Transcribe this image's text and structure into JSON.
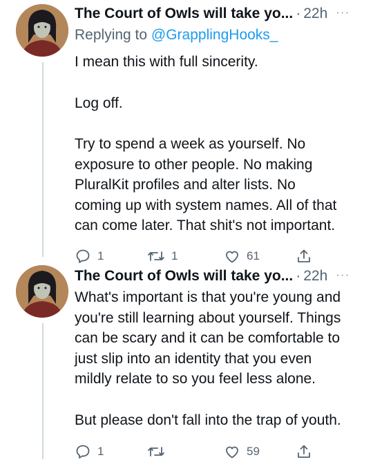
{
  "tweets": [
    {
      "display_name": "The Court of Owls will take yo...",
      "separator": "·",
      "time": "22h",
      "more": "···",
      "replying_prefix": "Replying to ",
      "replying_to": "@GrapplingHooks_",
      "paragraphs": [
        [
          "I mean this with full sincerity."
        ],
        [
          "Log off."
        ],
        [
          "Try to spend a week as yourself. No",
          "exposure to other people. No making",
          "PluralKit profiles and alter lists. No",
          "coming up with system names. All of that",
          "can come later. That shit's not important."
        ]
      ],
      "replies": "1",
      "retweets": "1",
      "likes": "61"
    },
    {
      "display_name": "The Court of Owls will take yo...",
      "separator": "·",
      "time": "22h",
      "more": "···",
      "paragraphs": [
        [
          "What's important is that you're young and",
          "you're still learning about yourself. Things",
          "can be scary and it can be comfortable to",
          "just slip into an identity that you even",
          "mildly relate to so you feel less alone."
        ],
        [
          "But please don't fall into the trap of youth."
        ]
      ],
      "replies": "1",
      "retweets": "",
      "likes": "59"
    }
  ],
  "icons": [
    "reply-icon",
    "retweet-icon",
    "like-icon",
    "share-icon",
    "more-icon"
  ],
  "colors": {
    "text": "#0f1419",
    "secondary": "#536471",
    "link": "#1d9bf0",
    "thread_line": "#cfd9de"
  }
}
